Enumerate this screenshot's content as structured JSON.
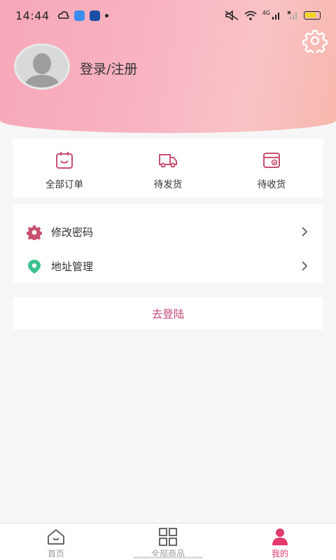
{
  "status_bar": {
    "time": "14:44",
    "network_label": "4G",
    "accent_battery": "#f5d21f"
  },
  "header": {
    "login_text": "登录/注册",
    "settings_icon": "gear-icon",
    "gradient_colors": [
      "#f7a7b8",
      "#f9c2c5",
      "#f8b7ad"
    ]
  },
  "orders": [
    {
      "label": "全部订单",
      "icon": "order-list-icon"
    },
    {
      "label": "待发货",
      "icon": "truck-icon"
    },
    {
      "label": "待收货",
      "icon": "receive-box-icon"
    }
  ],
  "menu": [
    {
      "label": "修改密码",
      "icon": "gear-icon",
      "color": "#c8506e"
    },
    {
      "label": "地址管理",
      "icon": "location-pin-icon",
      "color": "#39c28e"
    }
  ],
  "go_login_label": "去登陆",
  "tabs": [
    {
      "label": "首页",
      "icon": "home-icon",
      "active": false
    },
    {
      "label": "全部商品",
      "icon": "grid-icon",
      "active": false
    },
    {
      "label": "我的",
      "icon": "user-icon",
      "active": true
    }
  ],
  "colors": {
    "accent": "#e23b6b",
    "accent_dark": "#c24777",
    "icon_pink": "#c8506e"
  }
}
